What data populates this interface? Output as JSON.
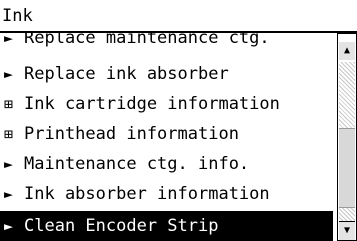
{
  "header": {
    "title": "Ink"
  },
  "menu": {
    "items": [
      {
        "marker": "►",
        "label": "Replace maintenance ctg."
      },
      {
        "marker": "►",
        "label": "Replace ink absorber"
      },
      {
        "marker": "⊞",
        "label": "Ink cartridge information"
      },
      {
        "marker": "⊞",
        "label": "Printhead information"
      },
      {
        "marker": "►",
        "label": "Maintenance ctg. info."
      },
      {
        "marker": "►",
        "label": "Ink absorber information"
      },
      {
        "marker": "►",
        "label": "Clean Encoder Strip"
      }
    ],
    "selected_index": 6
  },
  "scrollbar": {
    "up_glyph": "▲",
    "down_glyph": "▼"
  },
  "colors": {
    "foreground": "#000000",
    "background": "#ffffff",
    "selection_bg": "#000000",
    "selection_fg": "#ffffff"
  }
}
